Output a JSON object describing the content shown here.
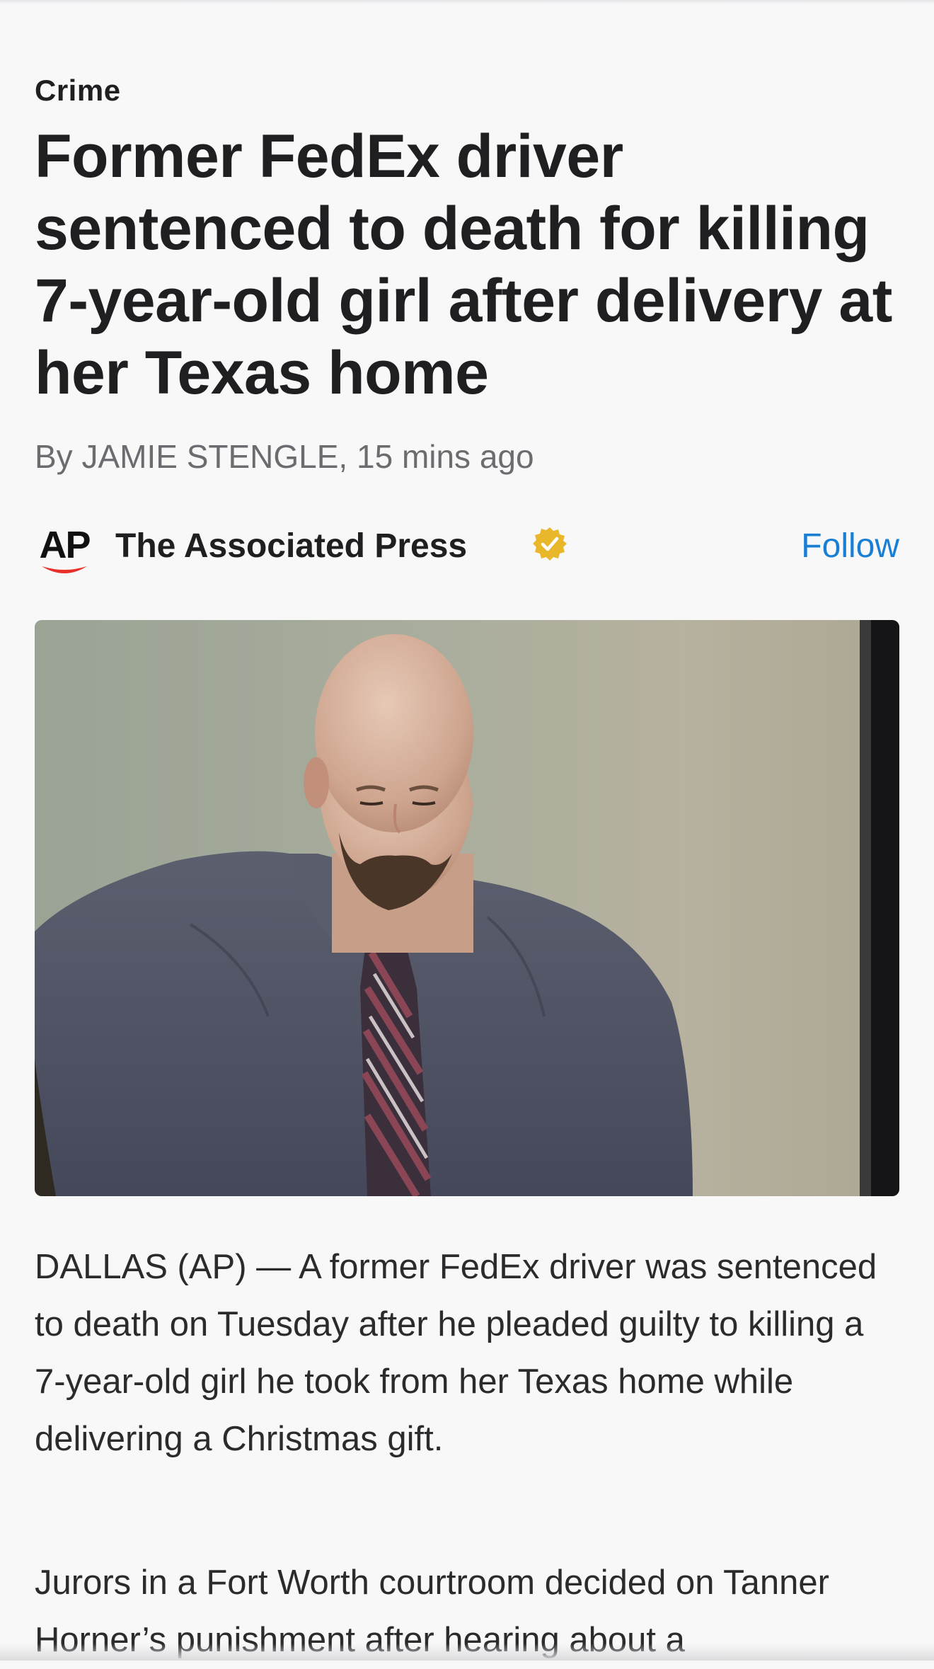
{
  "article": {
    "category": "Crime",
    "headline": "Former FedEx driver sentenced to death for killing 7-year-old girl after delivery at her Texas home",
    "byline": "By JAMIE STENGLE,  15 mins ago"
  },
  "publisher": {
    "logo_text": "AP",
    "name": "The Associated Press",
    "verified_icon": "verified-badge-icon",
    "follow_label": "Follow"
  },
  "hero_image": {
    "subject": "photo"
  },
  "body": {
    "paragraphs": [
      "DALLAS (AP) — A former FedEx driver was sentenced to death on Tuesday after he pleaded guilty to killing a 7-year-old girl he took from her Texas home while delivering a Christmas gift.",
      "Jurors in a Fort Worth courtroom decided on Tanner Horner’s punishment after hearing about a"
    ]
  },
  "colors": {
    "accent": "#1a7fd4",
    "ap_red": "#e8302a",
    "verified_gold": "#e9b72a",
    "text": "#1f1f21",
    "muted": "#6b6b70",
    "background": "#f8f8f9"
  }
}
